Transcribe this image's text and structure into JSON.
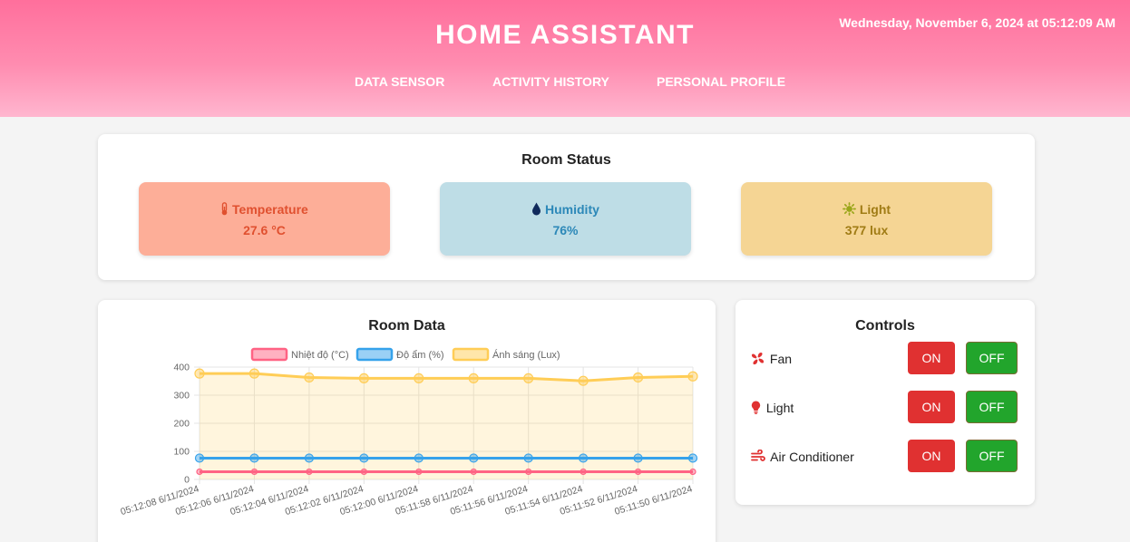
{
  "header": {
    "title": "HOME ASSISTANT",
    "datetime": "Wednesday, November 6, 2024 at 05:12:09 AM",
    "nav": [
      "DATA SENSOR",
      "ACTIVITY HISTORY",
      "PERSONAL PROFILE"
    ]
  },
  "room_status": {
    "title": "Room Status",
    "temperature": {
      "label": "Temperature",
      "value": "27.6 °C",
      "icon": "thermometer-icon",
      "bg": "#fdae98",
      "color": "#e0502f"
    },
    "humidity": {
      "label": "Humidity",
      "value": "76%",
      "icon": "droplet-icon",
      "bg": "#bedde6",
      "color": "#2c88b8"
    },
    "light": {
      "label": "Light",
      "value": "377 lux",
      "icon": "sun-icon",
      "bg": "#f5d594",
      "color": "#a07c15"
    }
  },
  "room_data": {
    "title": "Room Data"
  },
  "controls": {
    "title": "Controls",
    "items": [
      {
        "label": "Fan",
        "icon": "fan-icon",
        "on_label": "ON",
        "off_label": "OFF"
      },
      {
        "label": "Light",
        "icon": "lightbulb-icon",
        "on_label": "ON",
        "off_label": "OFF"
      },
      {
        "label": "Air Conditioner",
        "icon": "wind-icon",
        "on_label": "ON",
        "off_label": "OFF"
      }
    ]
  },
  "chart_data": {
    "type": "line",
    "title": "",
    "x": [
      "05:12:08 6/11/2024",
      "05:12:06 6/11/2024",
      "05:12:04 6/11/2024",
      "05:12:02 6/11/2024",
      "05:12:00 6/11/2024",
      "05:11:58 6/11/2024",
      "05:11:56 6/11/2024",
      "05:11:54 6/11/2024",
      "05:11:52 6/11/2024",
      "05:11:50 6/11/2024"
    ],
    "series": [
      {
        "name": "Nhiệt độ (°C)",
        "color": "#ff6384",
        "fill": false,
        "values": [
          27.6,
          27.6,
          27.6,
          27.6,
          27.6,
          27.6,
          27.6,
          27.6,
          27.6,
          27.6
        ]
      },
      {
        "name": "Độ ẩm (%)",
        "color": "#36a2eb",
        "fill": false,
        "values": [
          76,
          76,
          76,
          76,
          76,
          76,
          76,
          76,
          76,
          76
        ]
      },
      {
        "name": "Ánh sáng (Lux)",
        "color": "#ffcd56",
        "fill": true,
        "values": [
          377,
          377,
          363,
          360,
          360,
          360,
          360,
          351,
          363,
          367
        ]
      }
    ],
    "yticks": [
      0,
      100,
      200,
      300,
      400
    ],
    "ylim": [
      0,
      400
    ],
    "legend": "top",
    "grid": true
  }
}
